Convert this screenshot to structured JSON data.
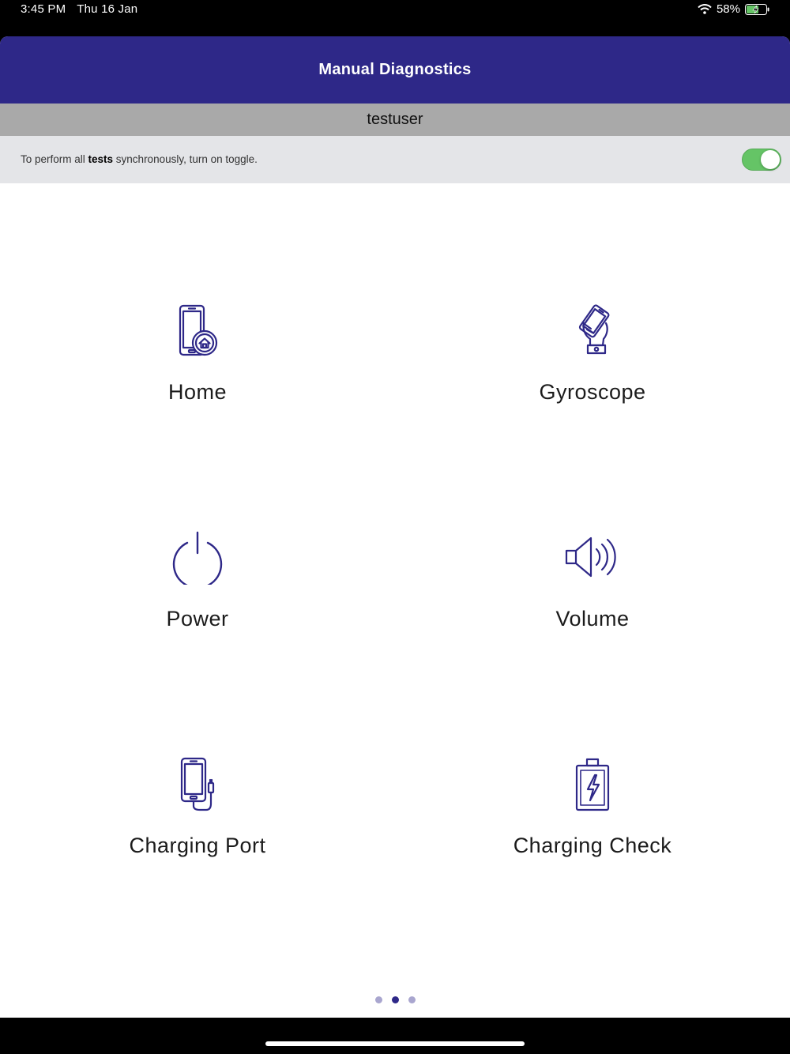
{
  "status_bar": {
    "time": "3:45 PM",
    "date": "Thu 16 Jan",
    "battery_percent": "58%",
    "battery_level": 0.58
  },
  "nav": {
    "title": "Manual Diagnostics"
  },
  "user": {
    "name": "testuser"
  },
  "sync_toggle": {
    "text_before": "To perform all ",
    "text_bold": "tests",
    "text_after": " synchronously, turn on toggle.",
    "on": true
  },
  "tests": [
    {
      "label": "Home",
      "icon": "phone-home-icon"
    },
    {
      "label": "Gyroscope",
      "icon": "gyroscope-hand-phone-icon"
    },
    {
      "label": "Power",
      "icon": "power-icon"
    },
    {
      "label": "Volume",
      "icon": "speaker-volume-icon"
    },
    {
      "label": "Charging Port",
      "icon": "phone-charging-cable-icon"
    },
    {
      "label": "Charging Check",
      "icon": "battery-charging-icon"
    }
  ],
  "pagination": {
    "pages": 3,
    "current": 2
  },
  "colors": {
    "brand": "#2e2888",
    "toggle_on": "#65c466",
    "user_bar": "#a9a9a9",
    "toggle_bar": "#e4e5e8"
  }
}
